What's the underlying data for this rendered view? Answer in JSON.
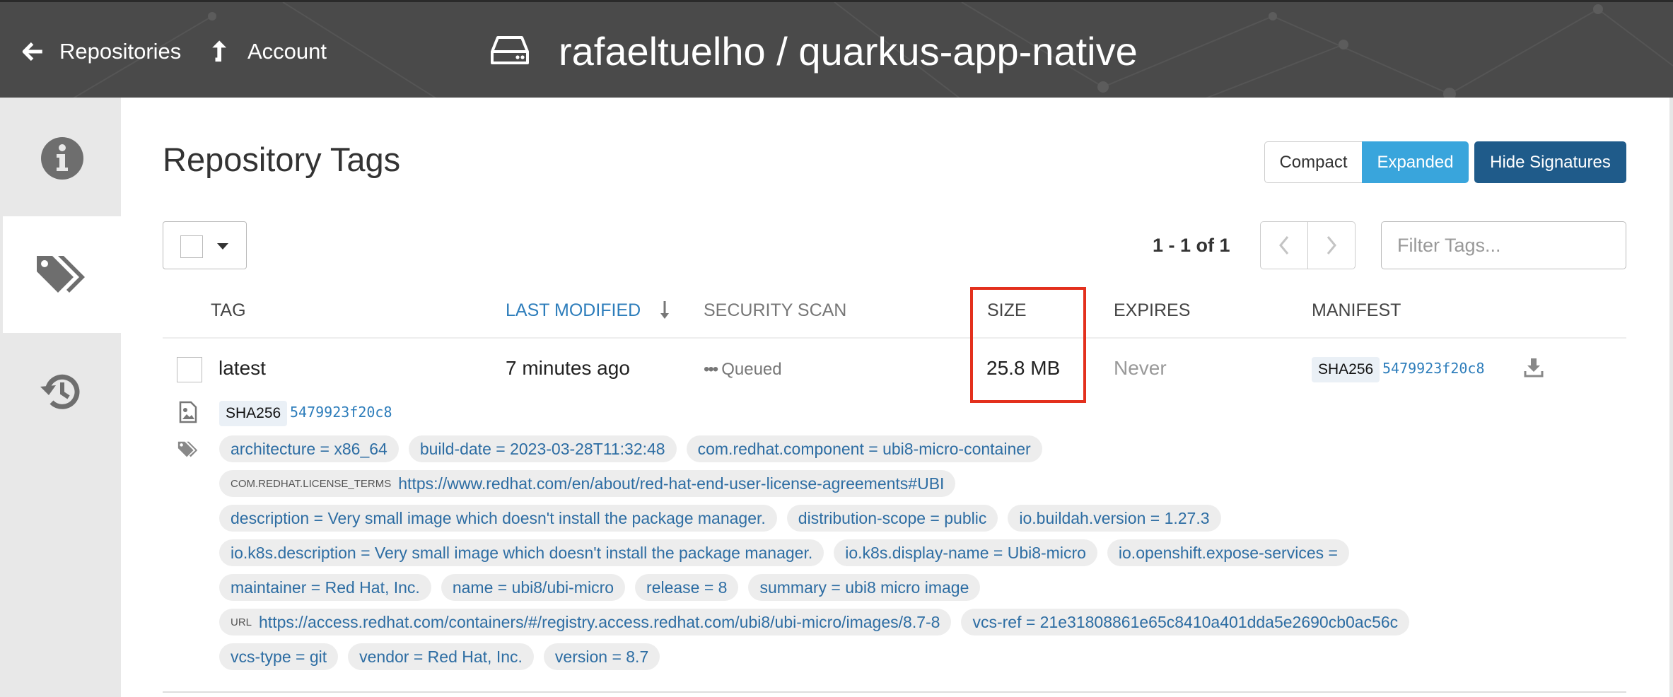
{
  "header": {
    "back_label": "Repositories",
    "account_label": "Account",
    "repo_path": "rafaeltuelho / quarkus-app-native"
  },
  "sidebar": {
    "tabs": [
      {
        "icon": "info-icon",
        "active": false
      },
      {
        "icon": "tags-icon",
        "active": true
      },
      {
        "icon": "history-icon",
        "active": false
      }
    ]
  },
  "page": {
    "title": "Repository Tags"
  },
  "view_toggle": {
    "compact_label": "Compact",
    "expanded_label": "Expanded",
    "hide_signatures_label": "Hide Signatures",
    "selected": "Expanded"
  },
  "pagination": {
    "range_text": "1 - 1 of 1",
    "prev_icon": "chevron-left-icon",
    "next_icon": "chevron-right-icon"
  },
  "filter": {
    "placeholder": "Filter Tags...",
    "value": ""
  },
  "table": {
    "columns": {
      "tag": "TAG",
      "last_modified": "LAST MODIFIED",
      "security_scan": "SECURITY SCAN",
      "size": "SIZE",
      "expires": "EXPIRES",
      "manifest": "MANIFEST"
    },
    "sorted_by": "LAST MODIFIED",
    "rows": [
      {
        "tag": "latest",
        "last_modified": "7 minutes ago",
        "security_scan": "Queued",
        "size": "25.8 MB",
        "expires": "Never",
        "manifest_algo": "SHA256",
        "manifest_digest": "5479923f20c8"
      }
    ]
  },
  "expanded": {
    "image_digest_algo": "SHA256",
    "image_digest": "5479923f20c8",
    "label_rows": [
      [
        {
          "text": "architecture = x86_64"
        },
        {
          "text": "build-date = 2023-03-28T11:32:48"
        },
        {
          "text": "com.redhat.component = ubi8-micro-container"
        }
      ],
      [
        {
          "key": "COM.REDHAT.LICENSE_TERMS",
          "text": "https://www.redhat.com/en/about/red-hat-end-user-license-agreements#UBI"
        }
      ],
      [
        {
          "text": "description = Very small image which doesn't install the package manager."
        },
        {
          "text": "distribution-scope = public"
        },
        {
          "text": "io.buildah.version = 1.27.3"
        }
      ],
      [
        {
          "text": "io.k8s.description = Very small image which doesn't install the package manager."
        },
        {
          "text": "io.k8s.display-name = Ubi8-micro"
        },
        {
          "text": "io.openshift.expose-services ="
        }
      ],
      [
        {
          "text": "maintainer = Red Hat, Inc."
        },
        {
          "text": "name = ubi8/ubi-micro"
        },
        {
          "text": "release = 8"
        },
        {
          "text": "summary = ubi8 micro image"
        }
      ],
      [
        {
          "key": "URL",
          "text": "https://access.redhat.com/containers/#/registry.access.redhat.com/ubi8/ubi-micro/images/8.7-8"
        },
        {
          "text": "vcs-ref = 21e31808861e65c8410a401dda5e2690cb0ac56c"
        }
      ],
      [
        {
          "text": "vcs-type = git"
        },
        {
          "text": "vendor = Red Hat, Inc."
        },
        {
          "text": "version = 8.7"
        }
      ]
    ]
  },
  "colors": {
    "header_bg": "#4a4a4a",
    "accent_blue": "#39a5dc",
    "primary_dark_blue": "#1f5b8a",
    "link_blue": "#2d7dbb",
    "highlight_red": "#e3301d"
  }
}
